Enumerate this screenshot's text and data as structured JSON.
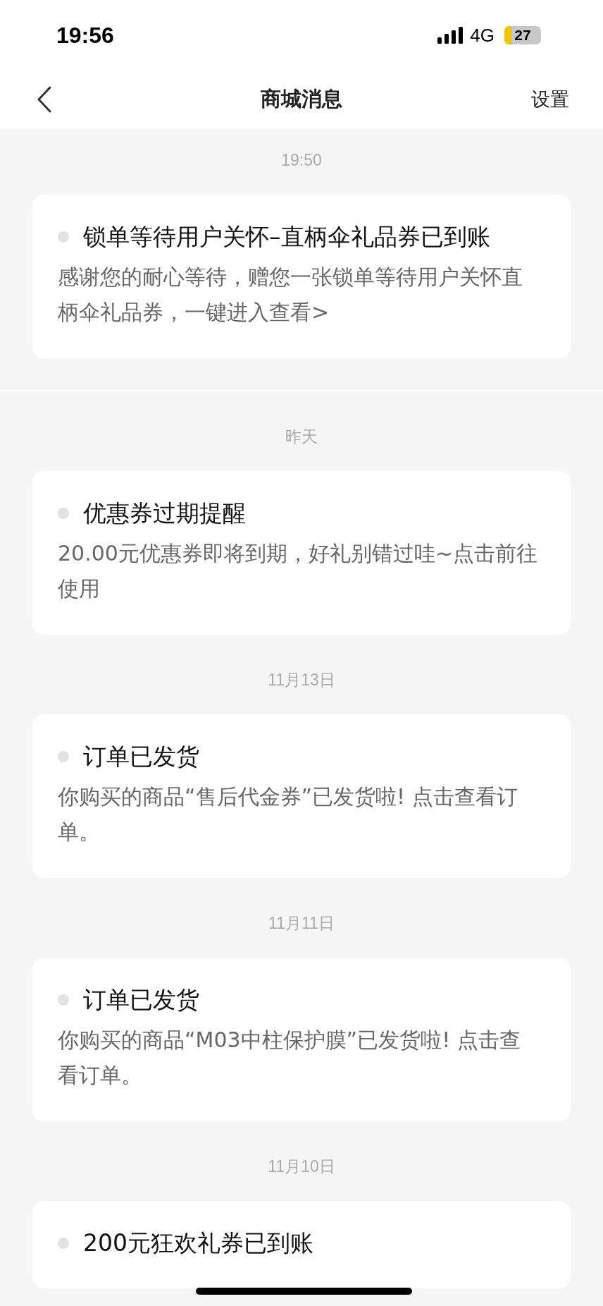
{
  "status_bar": {
    "time": "19:56",
    "network": "4G",
    "battery": "27"
  },
  "nav": {
    "title": "商城消息",
    "action": "设置"
  },
  "sections": [
    {
      "time": "19:50",
      "messages": [
        {
          "title": "锁单等待用户关怀–直柄伞礼品券已到账",
          "body": "感谢您的耐心等待，赠您一张锁单等待用户关怀直柄伞礼品券，一键进入查看>"
        }
      ]
    },
    {
      "time": "昨天",
      "messages": [
        {
          "title": "优惠券过期提醒",
          "body": "20.00元优惠券即将到期，好礼别错过哇~点击前往使用"
        }
      ]
    },
    {
      "time": "11月13日",
      "messages": [
        {
          "title": "订单已发货",
          "body": "你购买的商品“售后代金券”已发货啦! 点击查看订单。"
        }
      ]
    },
    {
      "time": "11月11日",
      "messages": [
        {
          "title": "订单已发货",
          "body": "你购买的商品“M03中柱保护膜”已发货啦! 点击查看订单。"
        }
      ]
    },
    {
      "time": "11月10日",
      "messages": [
        {
          "title": "200元狂欢礼券已到账"
        }
      ]
    }
  ]
}
